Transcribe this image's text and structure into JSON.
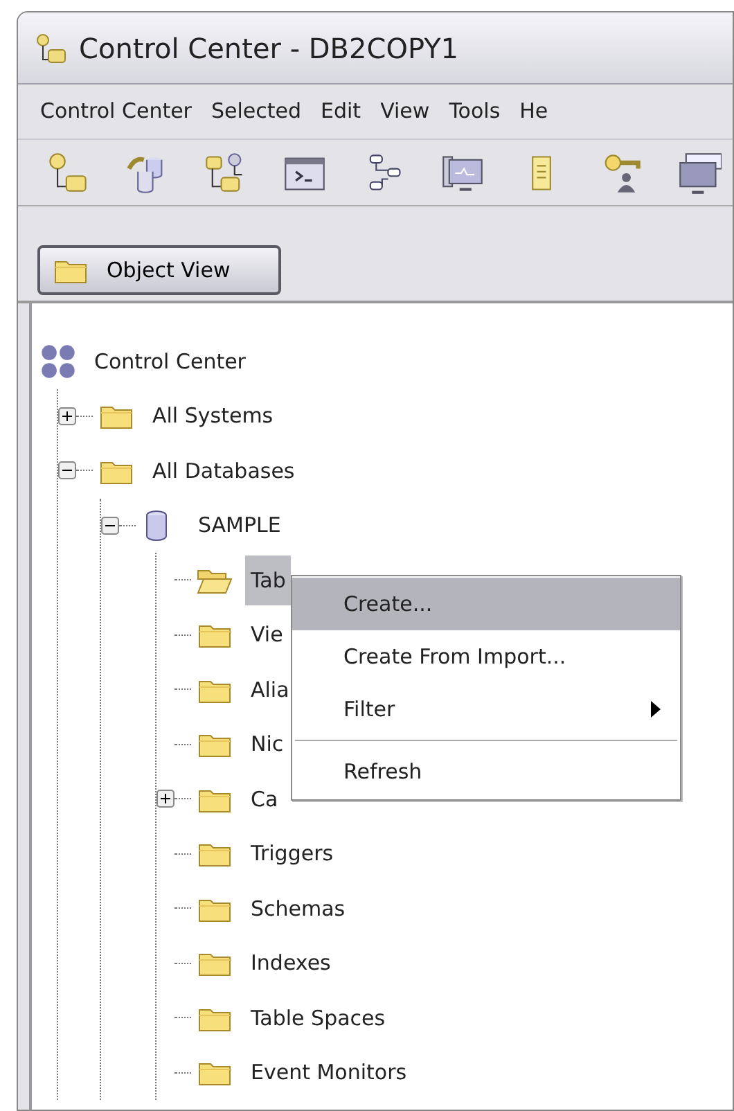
{
  "window": {
    "title": "Control Center - DB2COPY1"
  },
  "menu_bar": [
    "Control Center",
    "Selected",
    "Edit",
    "View",
    "Tools",
    "He"
  ],
  "tabs": [
    {
      "label": "Object View",
      "selected": true
    }
  ],
  "tree": [
    {
      "label": "Control Center",
      "kind": "root",
      "selected": false,
      "children": [
        {
          "label": "All Systems",
          "kind": "folder",
          "selected": false,
          "expanded": false
        },
        {
          "label": "All Databases",
          "kind": "folder",
          "selected": false,
          "expanded": true,
          "children": [
            {
              "label": "SAMPLE",
              "kind": "database",
              "selected": false,
              "expanded": true,
              "children": [
                {
                  "label": "Tab",
                  "kind": "folder",
                  "selected": true
                },
                {
                  "label": "Vie",
                  "kind": "folder",
                  "selected": false
                },
                {
                  "label": "Alia",
                  "kind": "folder",
                  "selected": false
                },
                {
                  "label": "Nic",
                  "kind": "folder",
                  "selected": false
                },
                {
                  "label": "Ca",
                  "kind": "folder",
                  "selected": false,
                  "expanded": false
                },
                {
                  "label": "Triggers",
                  "kind": "folder",
                  "selected": false
                },
                {
                  "label": "Schemas",
                  "kind": "folder",
                  "selected": false
                },
                {
                  "label": "Indexes",
                  "kind": "folder",
                  "selected": false
                },
                {
                  "label": "Table Spaces",
                  "kind": "folder",
                  "selected": false
                },
                {
                  "label": "Event Monitors",
                  "kind": "folder",
                  "selected": false
                }
              ]
            }
          ]
        }
      ]
    }
  ],
  "context_menu": [
    {
      "kind": "item",
      "label": "Create...",
      "selected": true
    },
    {
      "kind": "item",
      "label": "Create From Import...",
      "selected": false
    },
    {
      "kind": "submenu",
      "label": "Filter",
      "selected": false
    },
    {
      "kind": "separator"
    },
    {
      "kind": "item",
      "label": "Refresh",
      "selected": false
    }
  ]
}
